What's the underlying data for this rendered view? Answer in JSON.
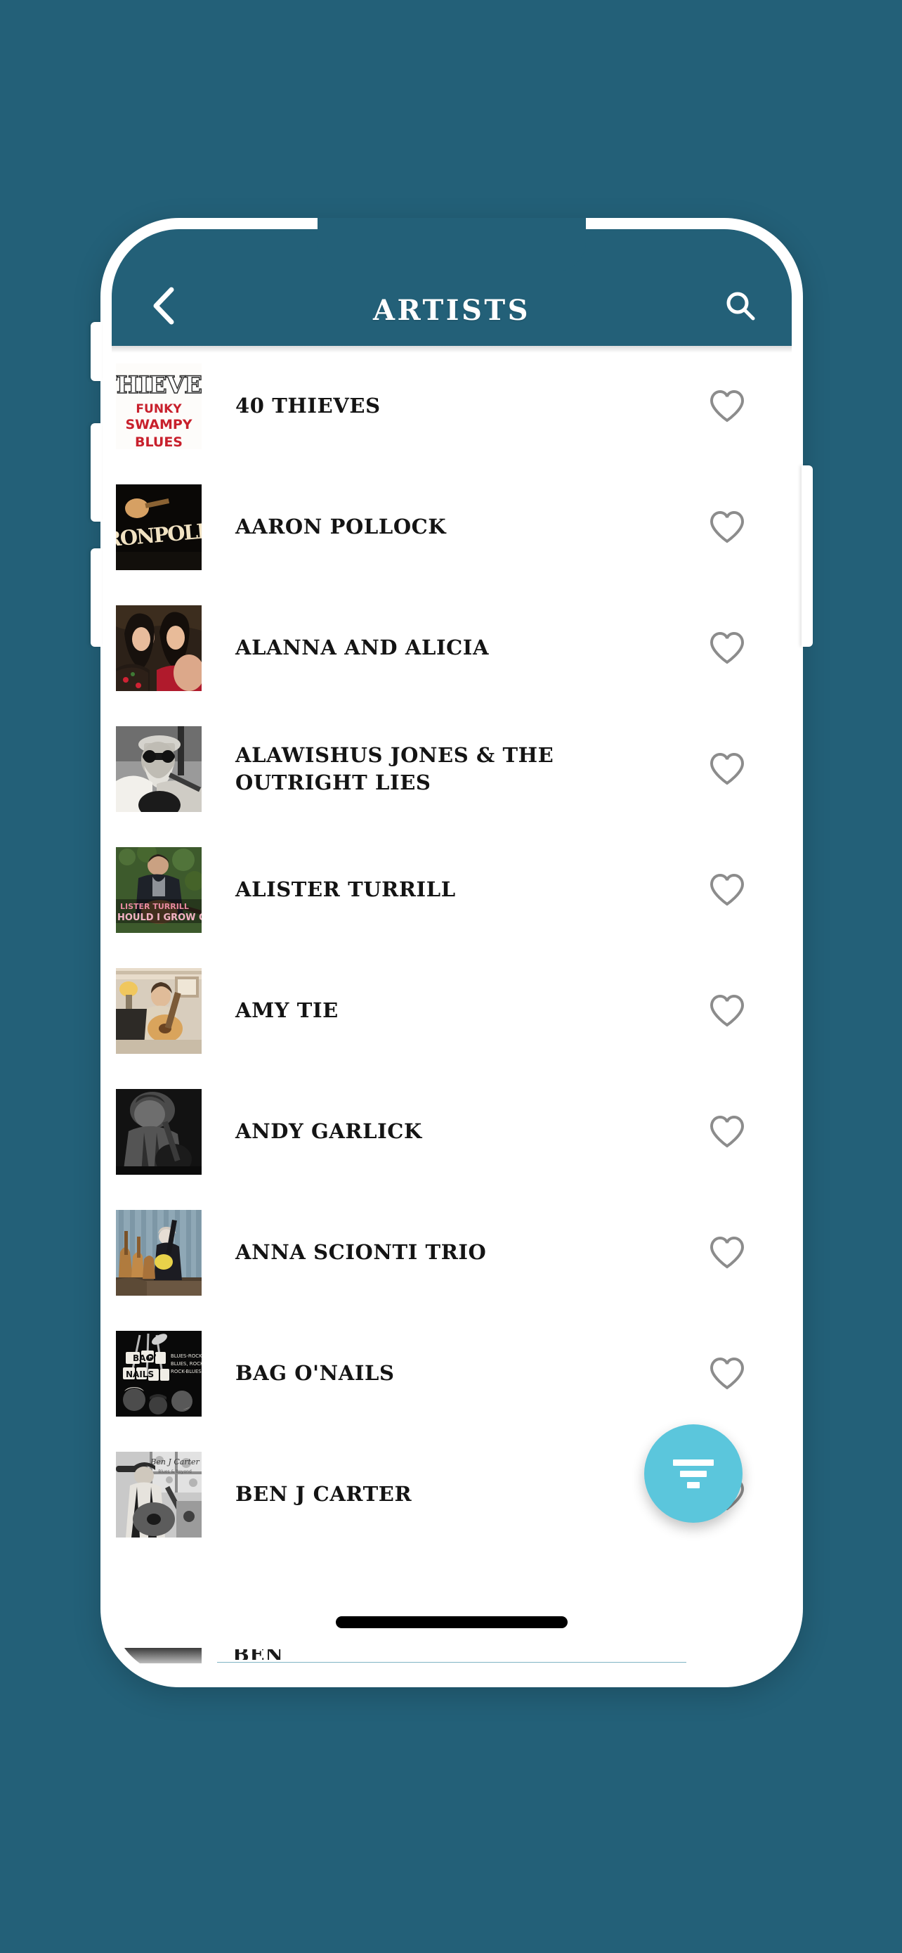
{
  "theme": {
    "background_color": "#236078",
    "appbar_color": "#236078",
    "accent_color": "#5BC6DC",
    "surface_color": "#FFFFFF",
    "heart_color": "#8C8C8C",
    "text_color": "#141414"
  },
  "appbar": {
    "title": "ARTISTS",
    "back_icon": "chevron-left-icon",
    "search_icon": "search-icon"
  },
  "fab": {
    "icon": "filter-icon",
    "label": "Filter"
  },
  "list": {
    "favorite_icon": "heart-outline-icon",
    "items": [
      {
        "name": "40 THIEVES",
        "favorited": false,
        "art": "thieves"
      },
      {
        "name": "AARON POLLOCK",
        "favorited": false,
        "art": "pollock"
      },
      {
        "name": "ALANNA AND ALICIA",
        "favorited": false,
        "art": "alanna"
      },
      {
        "name": "ALAWISHUS JONES & THE OUTRIGHT LIES",
        "favorited": false,
        "art": "alawishus"
      },
      {
        "name": "ALISTER TURRILL",
        "favorited": false,
        "art": "alister"
      },
      {
        "name": "AMY TIE",
        "favorited": false,
        "art": "amytie"
      },
      {
        "name": "ANDY GARLICK",
        "favorited": false,
        "art": "andy"
      },
      {
        "name": "ANNA SCIONTI TRIO",
        "favorited": false,
        "art": "anna"
      },
      {
        "name": "BAG O'NAILS",
        "favorited": false,
        "art": "bagonails"
      },
      {
        "name": "BEN J CARTER",
        "favorited": false,
        "art": "benj"
      }
    ],
    "partial_next_item": "BEN"
  },
  "device": {
    "buttons": [
      "silent-switch",
      "volume-up-button",
      "volume-down-button",
      "power-button"
    ],
    "home_indicator": true
  }
}
